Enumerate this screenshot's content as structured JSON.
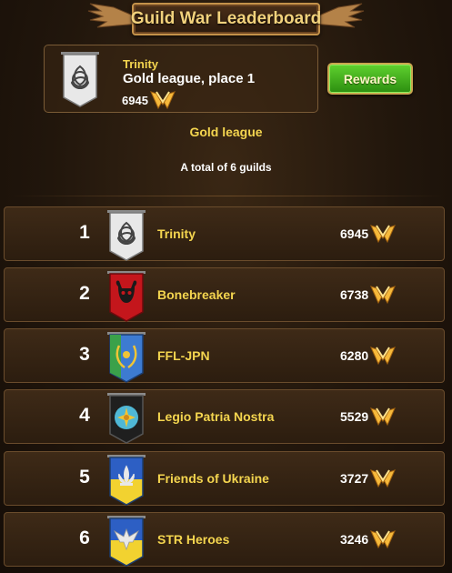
{
  "header": {
    "title": "Guild War Leaderboard"
  },
  "my_guild": {
    "name": "Trinity",
    "place_text": "Gold league, place 1",
    "score": "6945",
    "banner_icon": "triquetra-icon"
  },
  "rewards_button": {
    "label": "Rewards"
  },
  "league": {
    "name": "Gold league",
    "total_text": "A total of 6 guilds"
  },
  "leaderboard": [
    {
      "rank": "1",
      "name": "Trinity",
      "score": "6945",
      "banner": "triquetra-banner"
    },
    {
      "rank": "2",
      "name": "Bonebreaker",
      "score": "6738",
      "banner": "bull-skull-banner"
    },
    {
      "rank": "3",
      "name": "FFL-JPN",
      "score": "6280",
      "banner": "laurel-banner"
    },
    {
      "rank": "4",
      "name": "Legio Patria Nostra",
      "score": "5529",
      "banner": "sun-banner"
    },
    {
      "rank": "5",
      "name": "Friends of Ukraine",
      "score": "3727",
      "banner": "fleur-de-lis-banner"
    },
    {
      "rank": "6",
      "name": "STR Heroes",
      "score": "3246",
      "banner": "eagle-banner"
    }
  ],
  "colors": {
    "accent": "#f4d54f",
    "button_green": "#3fae1a",
    "frame": "#6a4c2c"
  }
}
